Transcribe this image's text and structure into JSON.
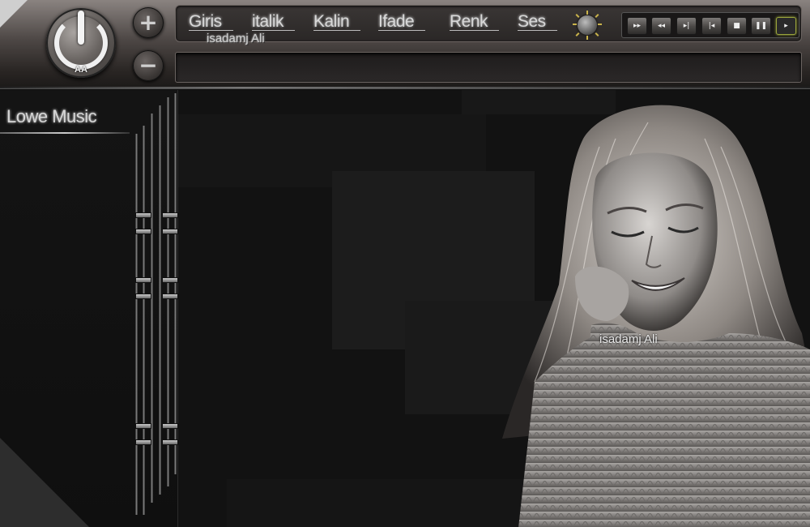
{
  "header": {
    "logo_text": "AA",
    "zoom_in_symbol": "+",
    "zoom_out_symbol": "−"
  },
  "menu": {
    "items": [
      "Giris",
      "italik",
      "Kalin",
      "Ifade",
      "Renk",
      "Ses"
    ],
    "sub_label": "isadamj Ali"
  },
  "transport": {
    "buttons": [
      {
        "name": "fast-forward",
        "symbol": "▸▸"
      },
      {
        "name": "rewind",
        "symbol": "◂◂"
      },
      {
        "name": "next",
        "symbol": "▸|"
      },
      {
        "name": "previous",
        "symbol": "|◂"
      },
      {
        "name": "stop",
        "symbol": "■"
      },
      {
        "name": "pause",
        "symbol": "❚❚"
      },
      {
        "name": "play",
        "symbol": "▸"
      }
    ],
    "active": "play"
  },
  "address_bar": {
    "value": ""
  },
  "sidebar": {
    "title": "Lowe Music"
  },
  "photo": {
    "watermark": "isadamj Ali"
  },
  "colors": {
    "accent_green": "#9aa53c",
    "brightness_rays": "#c9b34b",
    "header_top": "#8a8380",
    "background": "#121212"
  }
}
